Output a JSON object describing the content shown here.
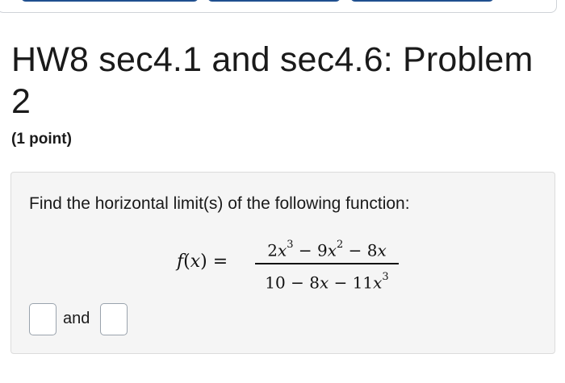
{
  "problem": {
    "title": "HW8 sec4.1 and sec4.6: Problem 2",
    "points": "(1 point)",
    "prompt": "Find the horizontal limit(s) of the following function:",
    "equation": {
      "lhs": "f(x) =",
      "numerator": "2x³ − 9x² − 8x",
      "denominator": "10 − 8x − 11x³"
    },
    "answer_joiner": "and",
    "answers": [
      "",
      ""
    ]
  },
  "colors": {
    "tab_accent": "#1f4f8f",
    "box_background": "#f5f5f5",
    "input_border": "#9aa3ad"
  }
}
